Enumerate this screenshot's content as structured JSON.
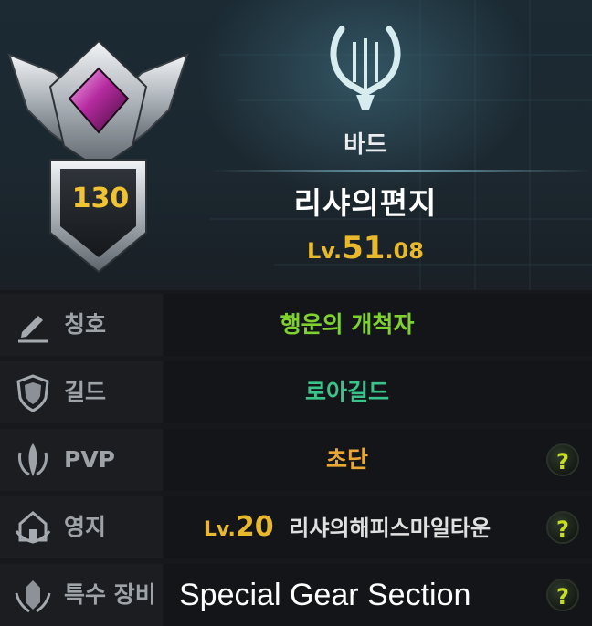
{
  "profile": {
    "class_name": "바드",
    "character_name": "리샤의편지",
    "item_level_prefix": "Lv.",
    "item_level_int": "51",
    "item_level_dec": ".08",
    "badge_level": "130",
    "class_icon": "harp-icon",
    "badge_icon": "winged-crest-icon"
  },
  "rows": {
    "title": {
      "label": "칭호",
      "value": "행운의 개척자",
      "icon": "pencil-icon",
      "color": "#7fd12f"
    },
    "guild": {
      "label": "길드",
      "value": "로아길드",
      "icon": "shield-icon",
      "color": "#39c48a"
    },
    "pvp": {
      "label": "PVP",
      "value": "초단",
      "icon": "pvp-emblem-icon",
      "color": "#eaa732",
      "help": "?"
    },
    "estate": {
      "label": "영지",
      "level_prefix": "Lv.",
      "level": "20",
      "value": "리샤의해피스마일타운",
      "icon": "estate-icon",
      "color": "#e0e0e0",
      "level_color": "#e8b92c",
      "help": "?"
    },
    "special_gear": {
      "label": "특수 장비",
      "overlay": "Special Gear Section",
      "icon": "special-gear-icon",
      "help": "?"
    }
  }
}
